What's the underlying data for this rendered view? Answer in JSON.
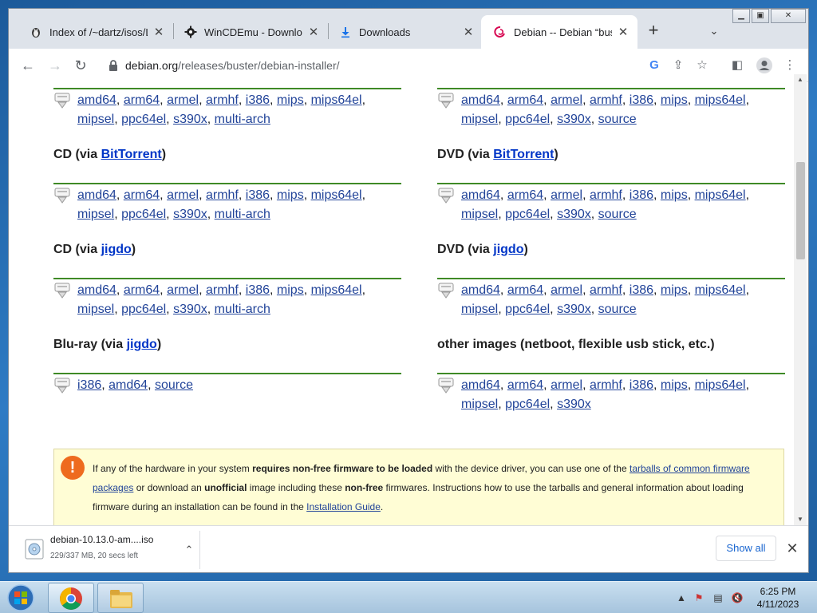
{
  "tabs": [
    {
      "title": "Index of /~dartz/isos/Li",
      "icon": "linux-icon"
    },
    {
      "title": "WinCDEmu - Download",
      "icon": "gear-icon"
    },
    {
      "title": "Downloads",
      "icon": "download-icon"
    },
    {
      "title": "Debian -- Debian “buste",
      "icon": "debian-swirl-icon"
    }
  ],
  "toolbar": {
    "url_host": "debian.org",
    "url_path": "/releases/buster/debian-installer/"
  },
  "sections": {
    "left": [
      {
        "heading": "",
        "heading_link": "",
        "heading_suffix": "",
        "links": [
          "amd64",
          "arm64",
          "armel",
          "armhf",
          "i386",
          "mips",
          "mips64el",
          "mipsel",
          "ppc64el",
          "s390x",
          "multi-arch"
        ]
      },
      {
        "heading": "CD (via ",
        "heading_link": "BitTorrent",
        "heading_suffix": ")",
        "links": [
          "amd64",
          "arm64",
          "armel",
          "armhf",
          "i386",
          "mips",
          "mips64el",
          "mipsel",
          "ppc64el",
          "s390x",
          "multi-arch"
        ]
      },
      {
        "heading": "CD (via ",
        "heading_link": "jigdo",
        "heading_suffix": ")",
        "links": [
          "amd64",
          "arm64",
          "armel",
          "armhf",
          "i386",
          "mips",
          "mips64el",
          "mipsel",
          "ppc64el",
          "s390x",
          "multi-arch"
        ]
      },
      {
        "heading": "Blu-ray (via ",
        "heading_link": "jigdo",
        "heading_suffix": ")",
        "links": [
          "i386",
          "amd64",
          "source"
        ]
      }
    ],
    "right": [
      {
        "heading": "",
        "heading_link": "",
        "heading_suffix": "",
        "links": [
          "amd64",
          "arm64",
          "armel",
          "armhf",
          "i386",
          "mips",
          "mips64el",
          "mipsel",
          "ppc64el",
          "s390x",
          "source"
        ]
      },
      {
        "heading": "DVD (via ",
        "heading_link": "BitTorrent",
        "heading_suffix": ")",
        "links": [
          "amd64",
          "arm64",
          "armel",
          "armhf",
          "i386",
          "mips",
          "mips64el",
          "mipsel",
          "ppc64el",
          "s390x",
          "source"
        ]
      },
      {
        "heading": "DVD (via ",
        "heading_link": "jigdo",
        "heading_suffix": ")",
        "links": [
          "amd64",
          "arm64",
          "armel",
          "armhf",
          "i386",
          "mips",
          "mips64el",
          "mipsel",
          "ppc64el",
          "s390x",
          "source"
        ]
      },
      {
        "heading": "other images (netboot, flexible usb stick, etc.)",
        "heading_link": "",
        "heading_suffix": "",
        "links": [
          "amd64",
          "arm64",
          "armel",
          "armhf",
          "i386",
          "mips",
          "mips64el",
          "mipsel",
          "ppc64el",
          "s390x"
        ]
      }
    ]
  },
  "notice": {
    "p1": "If any of the hardware in your system ",
    "b1": "requires non-free firmware to be loaded",
    "p2": " with the device driver, you can use one of the ",
    "link1": "tarballs of common firmware packages",
    "p3": " or download an ",
    "b2": "unofficial",
    "p4": " image including these ",
    "b3": "non-free",
    "p5": " firmwares. Instructions how to use the tarballs and general information about loading firmware during an installation can be found in the ",
    "link2": "Installation Guide",
    "p6": "."
  },
  "download": {
    "filename": "debian-10.13.0-am....iso",
    "status": "229/337 MB, 20 secs left",
    "show_all": "Show all"
  },
  "taskbar": {
    "time": "6:25 PM",
    "date": "4/11/2023"
  },
  "colors": {
    "rule": "#3f8a26",
    "link": "#224499",
    "notice_bg": "#fffdd5",
    "warning": "#ee6b1f"
  }
}
